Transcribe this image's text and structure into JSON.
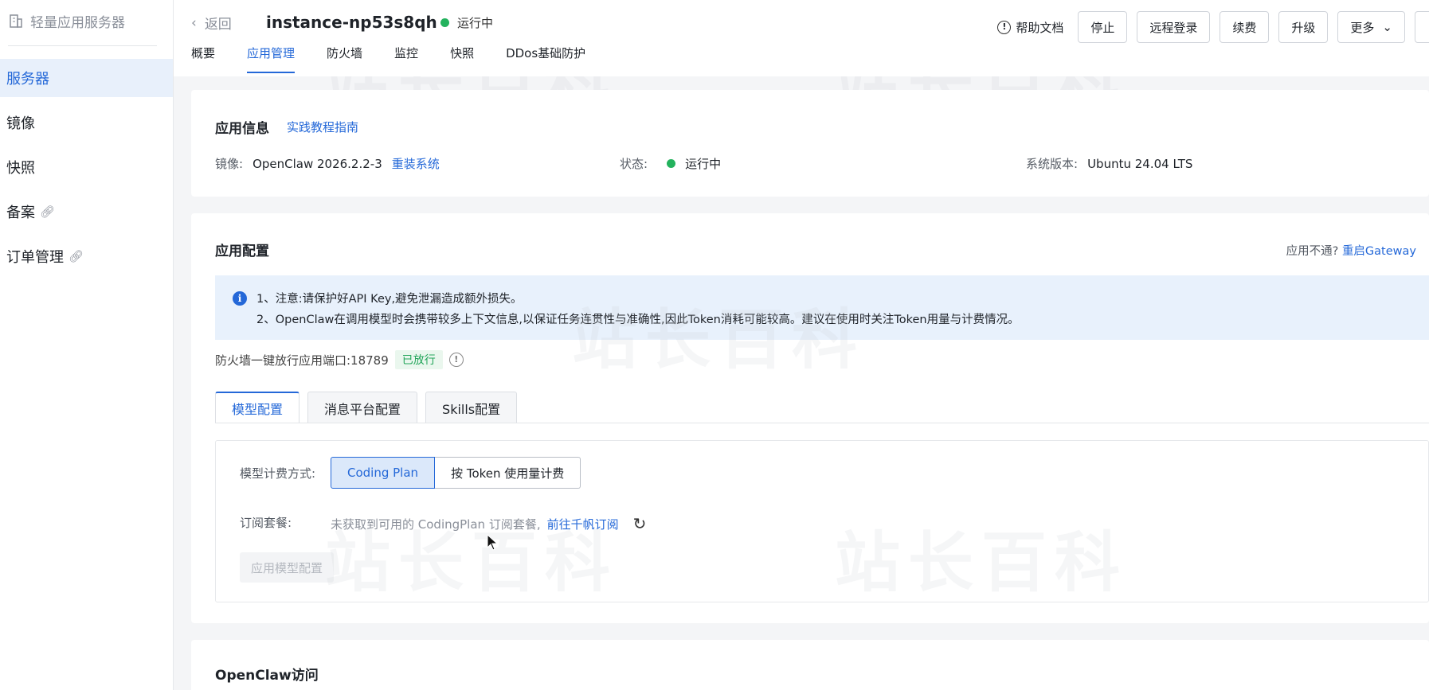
{
  "sidebar": {
    "header": "轻量应用服务器",
    "items": [
      {
        "label": "服务器",
        "active": true
      },
      {
        "label": "镜像"
      },
      {
        "label": "快照"
      },
      {
        "label": "备案",
        "link": true
      },
      {
        "label": "订单管理",
        "link": true
      }
    ]
  },
  "topbar": {
    "back_label": "返回",
    "instance_name": "instance-np53s8qh",
    "status": "运行中",
    "help_label": "帮助文档",
    "actions": [
      "停止",
      "远程登录",
      "续费",
      "升级",
      "更多"
    ]
  },
  "tabs": [
    "概要",
    "应用管理",
    "防火墙",
    "监控",
    "快照",
    "DDos基础防护"
  ],
  "app_info": {
    "title": "应用信息",
    "guide_link": "实践教程指南",
    "image_label": "镜像:",
    "image_value": "OpenClaw 2026.2.2-3",
    "reinstall_link": "重装系统",
    "status_label": "状态:",
    "status_value": "运行中",
    "os_label": "系统版本:",
    "os_value": "Ubuntu 24.04 LTS"
  },
  "app_config": {
    "title": "应用配置",
    "unavailable_text": "应用不通?",
    "restart_link": "重启Gateway",
    "notice_line1": "1、注意:请保护好API Key,避免泄漏造成额外损失。",
    "notice_line2": "2、OpenClaw在调用模型时会携带较多上下文信息,以保证任务连贯性与准确性,因此Token消耗可能较高。建议在使用时关注Token用量与计费情况。",
    "firewall_text": "防火墙一键放行应用端口:18789",
    "firewall_tag": "已放行",
    "sub_tabs": [
      "模型配置",
      "消息平台配置",
      "Skills配置"
    ],
    "billing_label": "模型计费方式:",
    "billing_options": [
      "Coding Plan",
      "按 Token 使用量计费"
    ],
    "subscription_label": "订阅套餐:",
    "subscription_text": "未获取到可用的 CodingPlan 订阅套餐,",
    "subscription_link": "前往千帆订阅",
    "apply_button": "应用模型配置"
  },
  "access": {
    "title": "OpenClaw访问"
  },
  "colors": {
    "accent": "#2468d8",
    "status_green": "#23b25d"
  }
}
